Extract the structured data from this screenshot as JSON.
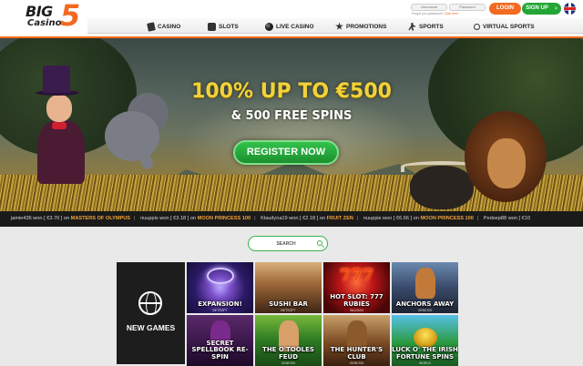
{
  "brand": {
    "logo_text_big": "BIG",
    "logo_text_casino": "Casino",
    "logo_text_number": "5"
  },
  "header": {
    "username_placeholder": "Username",
    "password_placeholder": "Password",
    "forgot_text": "Forgot you password? ",
    "forgot_link": "Click here",
    "login_label": "LOGIN",
    "signup_label": "SIGN UP",
    "arrow_icon": "chevron-right-icon",
    "flag_icon": "uk-flag-icon"
  },
  "nav": {
    "items": [
      {
        "label": "CASINO",
        "icon": "cards-icon"
      },
      {
        "label": "SLOTS",
        "icon": "slot-machine-icon"
      },
      {
        "label": "LIVE CASINO",
        "icon": "chip-icon"
      },
      {
        "label": "PROMOTIONS",
        "icon": "star-icon"
      },
      {
        "label": "SPORTS",
        "icon": "runner-icon"
      },
      {
        "label": "VIRTUAL SPORTS",
        "icon": "search-icon"
      }
    ]
  },
  "hero": {
    "headline": "100% UP TO €500",
    "subheadline": "& 500 FREE SPINS",
    "cta_label": "REGISTER NOW"
  },
  "ticker": {
    "items": [
      {
        "user": "jamie436",
        "amount": "€3.70",
        "game": "MASTERS OF OLYMPUS"
      },
      {
        "user": "nuuppis",
        "amount": "€3.18",
        "game": "MOON PRINCESS 100"
      },
      {
        "user": "Klaudyna19",
        "amount": "€2.18",
        "game": "FRUIT ZEN"
      },
      {
        "user": "nuuppis",
        "amount": "€6.66",
        "game": "MOON PRINCESS 100"
      },
      {
        "user": "Pedsep88",
        "amount": "€10",
        "game": ""
      }
    ],
    "won_word": "won",
    "on_word": "on"
  },
  "search": {
    "placeholder": "SEARCH"
  },
  "games": {
    "new_games_label": "NEW GAMES",
    "tiles": [
      {
        "title": "EXPANSION!",
        "provider": "BETSOFT"
      },
      {
        "title": "SUSHI BAR",
        "provider": "BETSOFT"
      },
      {
        "title": "HOT SLOT: 777 RUBIES",
        "provider": "WAZDAN"
      },
      {
        "title": "ANCHORS AWAY",
        "provider": "GENESIS"
      },
      {
        "title": "SECRET SPELLBOOK RE-SPIN",
        "provider": ""
      },
      {
        "title": "THE O'TOOLES FEUD",
        "provider": "GENESIS"
      },
      {
        "title": "THE HUNTER'S CLUB",
        "provider": "GENESIS"
      },
      {
        "title": "LUCK O' THE IRISH FORTUNE SPINS",
        "provider": "WORLD"
      }
    ]
  },
  "colors": {
    "accent_orange": "#f26a21",
    "accent_green": "#23a637",
    "ticker_game": "#f2a43a",
    "headline_gold": "#f2d23a"
  }
}
